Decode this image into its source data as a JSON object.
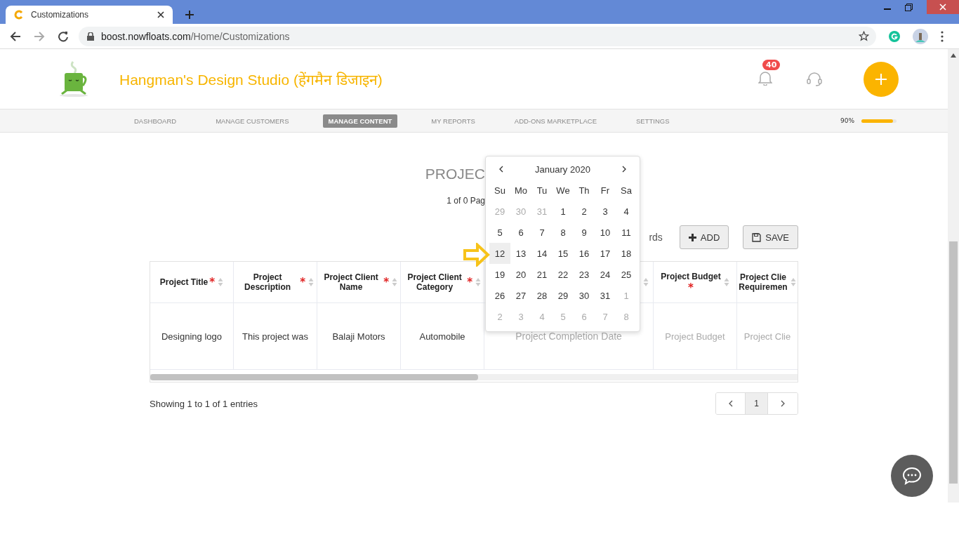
{
  "browser": {
    "tab_title": "Customizations",
    "url_host": "boost.nowfloats.com",
    "url_path": "/Home/Customizations"
  },
  "header": {
    "business_name": "Hangman's Design Studio (हेंगमैन डिजाइन)",
    "notification_count": "40"
  },
  "nav": {
    "items": [
      {
        "label": "DASHBOARD",
        "selected": false
      },
      {
        "label": "MANAGE CUSTOMERS",
        "selected": false
      },
      {
        "label": "MANAGE CONTENT",
        "selected": true
      },
      {
        "label": "MY REPORTS",
        "selected": false
      },
      {
        "label": "ADD-ONS MARKETPLACE",
        "selected": false
      },
      {
        "label": "SETTINGS",
        "selected": false
      }
    ],
    "progress_label": "90%",
    "level": 0.9
  },
  "page": {
    "title": "PROJEC",
    "page_info": "1 of 0 Pag",
    "records_text": "rds",
    "buttons": [
      {
        "label": "ADD",
        "kind": "add"
      },
      {
        "label": "SAVE",
        "kind": "save"
      }
    ]
  },
  "table": {
    "columns": [
      {
        "label": "Project Title",
        "required_mark": "*"
      },
      {
        "label": "Project Description",
        "required_mark": "*"
      },
      {
        "label": "Project Client Name",
        "required_mark": "*"
      },
      {
        "label": "Project Client Category",
        "required_mark": "*"
      },
      {},
      {
        "label": "Project Budget",
        "required_mark": "*"
      },
      {
        "label": "Project Clie Requiremen"
      }
    ],
    "rows": [
      [
        {
          "value": "Designing logo"
        },
        {
          "value": "This project was"
        },
        {
          "value": "Balaji Motors"
        },
        {
          "value": "Automobile"
        },
        {
          "placeholder": "Project Completion Date"
        },
        {
          "placeholder": "Project Budget"
        },
        {
          "placeholder": "Project Clie"
        }
      ]
    ],
    "footer": "Showing 1 to 1 of 1 entries",
    "pages": [
      {
        "label": "1",
        "selected": true
      }
    ]
  },
  "datepicker": {
    "month": "January 2020",
    "weekdays": [
      "Su",
      "Mo",
      "Tu",
      "We",
      "Th",
      "Fr",
      "Sa"
    ],
    "weeks": [
      [
        {
          "day": "29",
          "muted": true,
          "selected": false
        },
        {
          "day": "30",
          "muted": true,
          "selected": false
        },
        {
          "day": "31",
          "muted": true,
          "selected": false
        },
        {
          "day": "1",
          "muted": false,
          "selected": false
        },
        {
          "day": "2",
          "muted": false,
          "selected": false
        },
        {
          "day": "3",
          "muted": false,
          "selected": false
        },
        {
          "day": "4",
          "muted": false,
          "selected": false
        }
      ],
      [
        {
          "day": "5",
          "muted": false,
          "selected": false
        },
        {
          "day": "6",
          "muted": false,
          "selected": false
        },
        {
          "day": "7",
          "muted": false,
          "selected": false
        },
        {
          "day": "8",
          "muted": false,
          "selected": false
        },
        {
          "day": "9",
          "muted": false,
          "selected": false
        },
        {
          "day": "10",
          "muted": false,
          "selected": false
        },
        {
          "day": "11",
          "muted": false,
          "selected": false
        }
      ],
      [
        {
          "day": "12",
          "muted": false,
          "selected": true
        },
        {
          "day": "13",
          "muted": false,
          "selected": false
        },
        {
          "day": "14",
          "muted": false,
          "selected": false
        },
        {
          "day": "15",
          "muted": false,
          "selected": false
        },
        {
          "day": "16",
          "muted": false,
          "selected": false
        },
        {
          "day": "17",
          "muted": false,
          "selected": false
        },
        {
          "day": "18",
          "muted": false,
          "selected": false
        }
      ],
      [
        {
          "day": "19",
          "muted": false,
          "selected": false
        },
        {
          "day": "20",
          "muted": false,
          "selected": false
        },
        {
          "day": "21",
          "muted": false,
          "selected": false
        },
        {
          "day": "22",
          "muted": false,
          "selected": false
        },
        {
          "day": "23",
          "muted": false,
          "selected": false
        },
        {
          "day": "24",
          "muted": false,
          "selected": false
        },
        {
          "day": "25",
          "muted": false,
          "selected": false
        }
      ],
      [
        {
          "day": "26",
          "muted": false,
          "selected": false
        },
        {
          "day": "27",
          "muted": false,
          "selected": false
        },
        {
          "day": "28",
          "muted": false,
          "selected": false
        },
        {
          "day": "29",
          "muted": false,
          "selected": false
        },
        {
          "day": "30",
          "muted": false,
          "selected": false
        },
        {
          "day": "31",
          "muted": false,
          "selected": false
        },
        {
          "day": "1",
          "muted": true,
          "selected": false
        }
      ],
      [
        {
          "day": "2",
          "muted": true,
          "selected": false
        },
        {
          "day": "3",
          "muted": true,
          "selected": false
        },
        {
          "day": "4",
          "muted": true,
          "selected": false
        },
        {
          "day": "5",
          "muted": true,
          "selected": false
        },
        {
          "day": "6",
          "muted": true,
          "selected": false
        },
        {
          "day": "7",
          "muted": true,
          "selected": false
        },
        {
          "day": "8",
          "muted": true,
          "selected": false
        }
      ]
    ]
  }
}
